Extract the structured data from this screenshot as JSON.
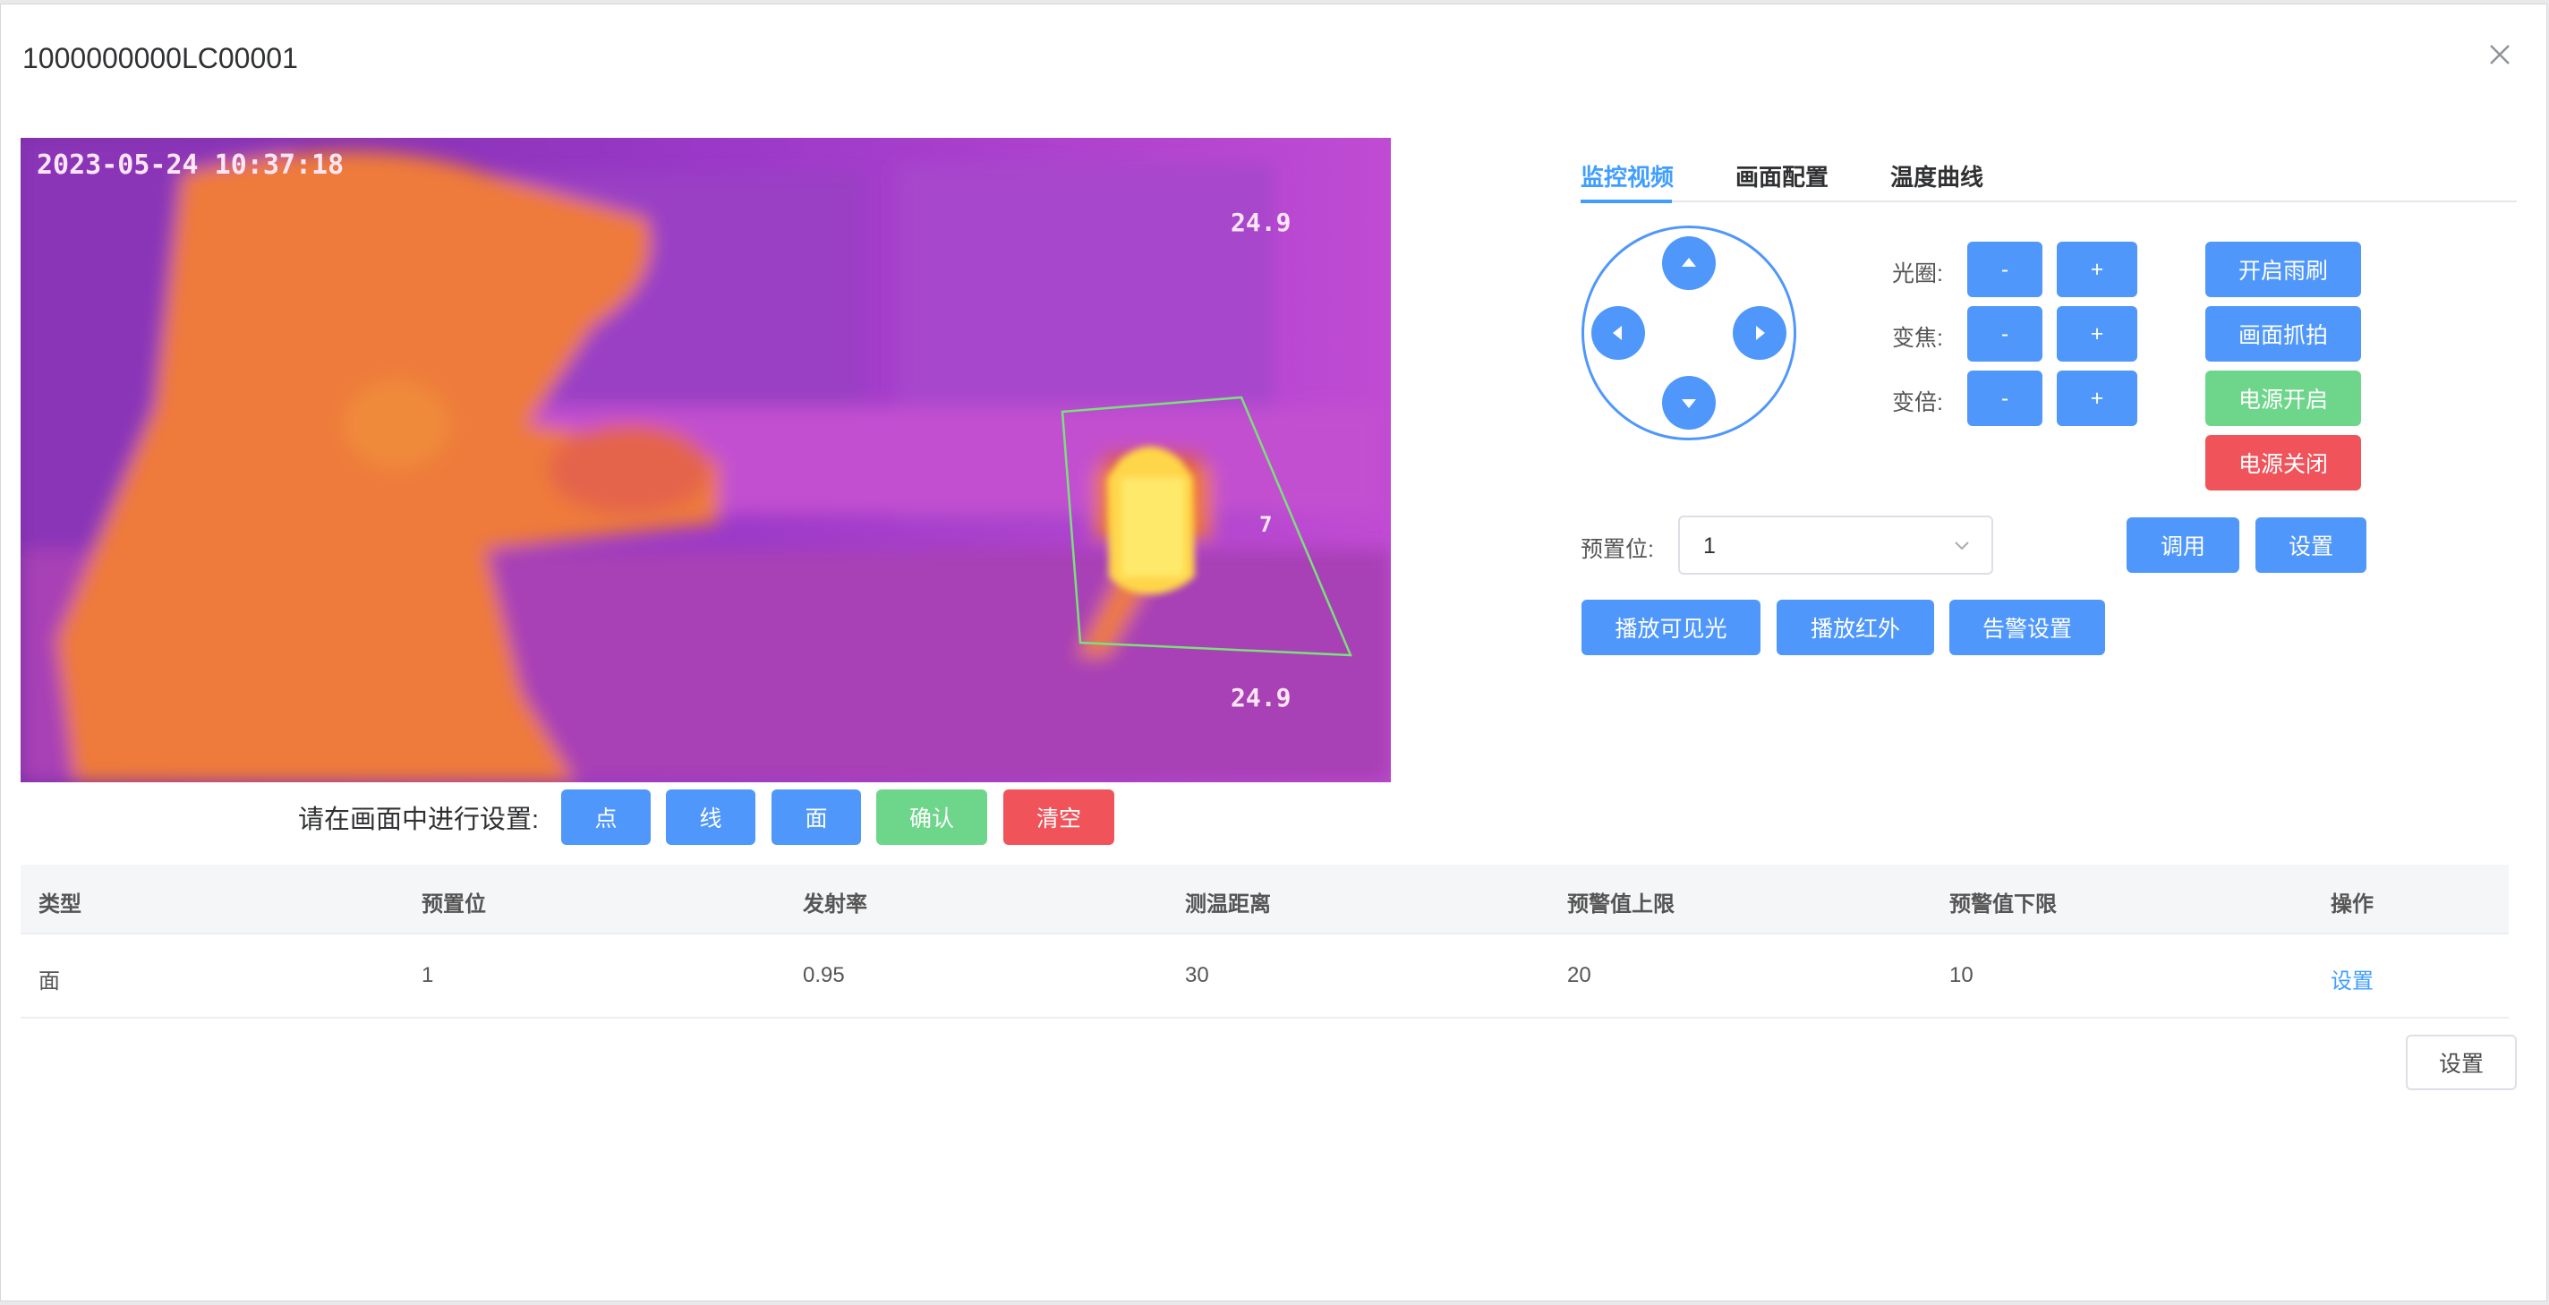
{
  "dialog": {
    "title": "1000000000LC00001"
  },
  "video": {
    "timestamp": "2023-05-24 10:37:18",
    "temp_top": "24.9",
    "temp_bottom": "24.9",
    "area_marker": "7"
  },
  "drawing": {
    "prompt": "请在画面中进行设置:",
    "point_label": "点",
    "line_label": "线",
    "area_label": "面",
    "confirm_label": "确认",
    "clear_label": "清空"
  },
  "tabs": [
    {
      "label": "监控视频",
      "active": true
    },
    {
      "label": "画面配置",
      "active": false
    },
    {
      "label": "温度曲线",
      "active": false
    }
  ],
  "controls": {
    "aperture_label": "光圈:",
    "focus_label": "变焦:",
    "zoom_label": "变倍:",
    "minus": "-",
    "plus": "+"
  },
  "actions": {
    "wiper_label": "开启雨刷",
    "snapshot_label": "画面抓拍",
    "power_on_label": "电源开启",
    "power_off_label": "电源关闭"
  },
  "preset": {
    "label": "预置位:",
    "value": "1",
    "call_label": "调用",
    "set_label": "设置"
  },
  "playback": {
    "visible_label": "播放可见光",
    "infrared_label": "播放红外",
    "alarm_label": "告警设置"
  },
  "table": {
    "headers": [
      "类型",
      "预置位",
      "发射率",
      "测温距离",
      "预警值上限",
      "预警值下限",
      "操作"
    ],
    "rows": [
      {
        "type": "面",
        "preset": "1",
        "emissivity": "0.95",
        "distance": "30",
        "upper": "20",
        "lower": "10",
        "action": "设置"
      }
    ]
  },
  "footer": {
    "settings_label": "设置"
  },
  "colors": {
    "primary": "#4f97fb",
    "success": "#6ed68a",
    "danger": "#f0545a",
    "link": "#409eff"
  }
}
